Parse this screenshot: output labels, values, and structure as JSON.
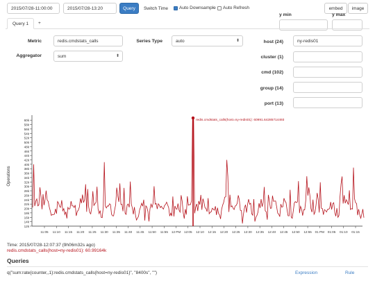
{
  "toolbar": {
    "start_time": "2015/07/28-11:00:00",
    "end_time": "2015/07/28-13:20",
    "query_label": "Query",
    "switch_time_label": "Switch Time",
    "auto_downsample_label": "Auto Downsample",
    "auto_downsample_checked": true,
    "auto_refresh_label": "Auto Refresh",
    "auto_refresh_checked": false,
    "embed_label": "embed",
    "image_label": "image"
  },
  "yaxis": {
    "ymin_label": "y min",
    "ymax_label": "y max",
    "ymin_value": "",
    "ymax_value": ""
  },
  "tabs": [
    {
      "label": "Query 1"
    },
    {
      "label": "+"
    }
  ],
  "form": {
    "metric_label": "Metric",
    "metric_value": "redis.cmdstats_calls",
    "series_type_label": "Series Type",
    "series_type_value": "auto",
    "aggregator_label": "Aggregator",
    "aggregator_value": "sum"
  },
  "tags": [
    {
      "label": "host (24)",
      "value": "ny-redis01"
    },
    {
      "label": "cluster (1)",
      "value": ""
    },
    {
      "label": "cmd (102)",
      "value": ""
    },
    {
      "label": "group (14)",
      "value": ""
    },
    {
      "label": "port (13)",
      "value": ""
    }
  ],
  "chart_data": {
    "type": "line",
    "ylabel": "Operations",
    "y_ticks": [
      "12k",
      "14k",
      "16k",
      "18k",
      "20k",
      "22k",
      "24k",
      "26k",
      "28k",
      "30k",
      "32k",
      "34k",
      "36k",
      "38k",
      "40k",
      "42k",
      "44k",
      "46k",
      "48k",
      "50k",
      "52k",
      "54k",
      "56k",
      "58k",
      "60k"
    ],
    "ylim": [
      12000,
      61000
    ],
    "x_ticks": [
      "11:05",
      "11:10",
      "11:15",
      "11:20",
      "11:25",
      "11:30",
      "11:35",
      "11:40",
      "11:45",
      "11:50",
      "11:55",
      "12 PM",
      "12:05",
      "12:10",
      "12:15",
      "12:20",
      "12:25",
      "12:30",
      "12:35",
      "12:40",
      "12:45",
      "12:50",
      "12:55",
      "01 PM",
      "01:05",
      "01:10",
      "01:15"
    ],
    "series": [
      {
        "name": "redis.cmdstats_calls{host=ny-redis01}",
        "color": "#b5121b"
      }
    ],
    "highlight": {
      "x": "12:07:37",
      "y": 60991.64285714493,
      "label": "redis.cmdstats_calls{host=ny-redis01}: 60991.64285714493"
    },
    "grid": false
  },
  "footer": {
    "time_text": "Time: 2015/07/28-12:07:37 (9h06m32s ago)",
    "value_text": "redis.cmdstats_calls{host=ny-redis01}: 60.99164k"
  },
  "queries": {
    "heading": "Queries",
    "row_text": "q(\"sum:rate{counter,,1}:redis.cmdstats_calls{host=ny-redis01}\", \"8400s\", \"\")",
    "expression_label": "Expression",
    "rule_label": "Rule"
  }
}
